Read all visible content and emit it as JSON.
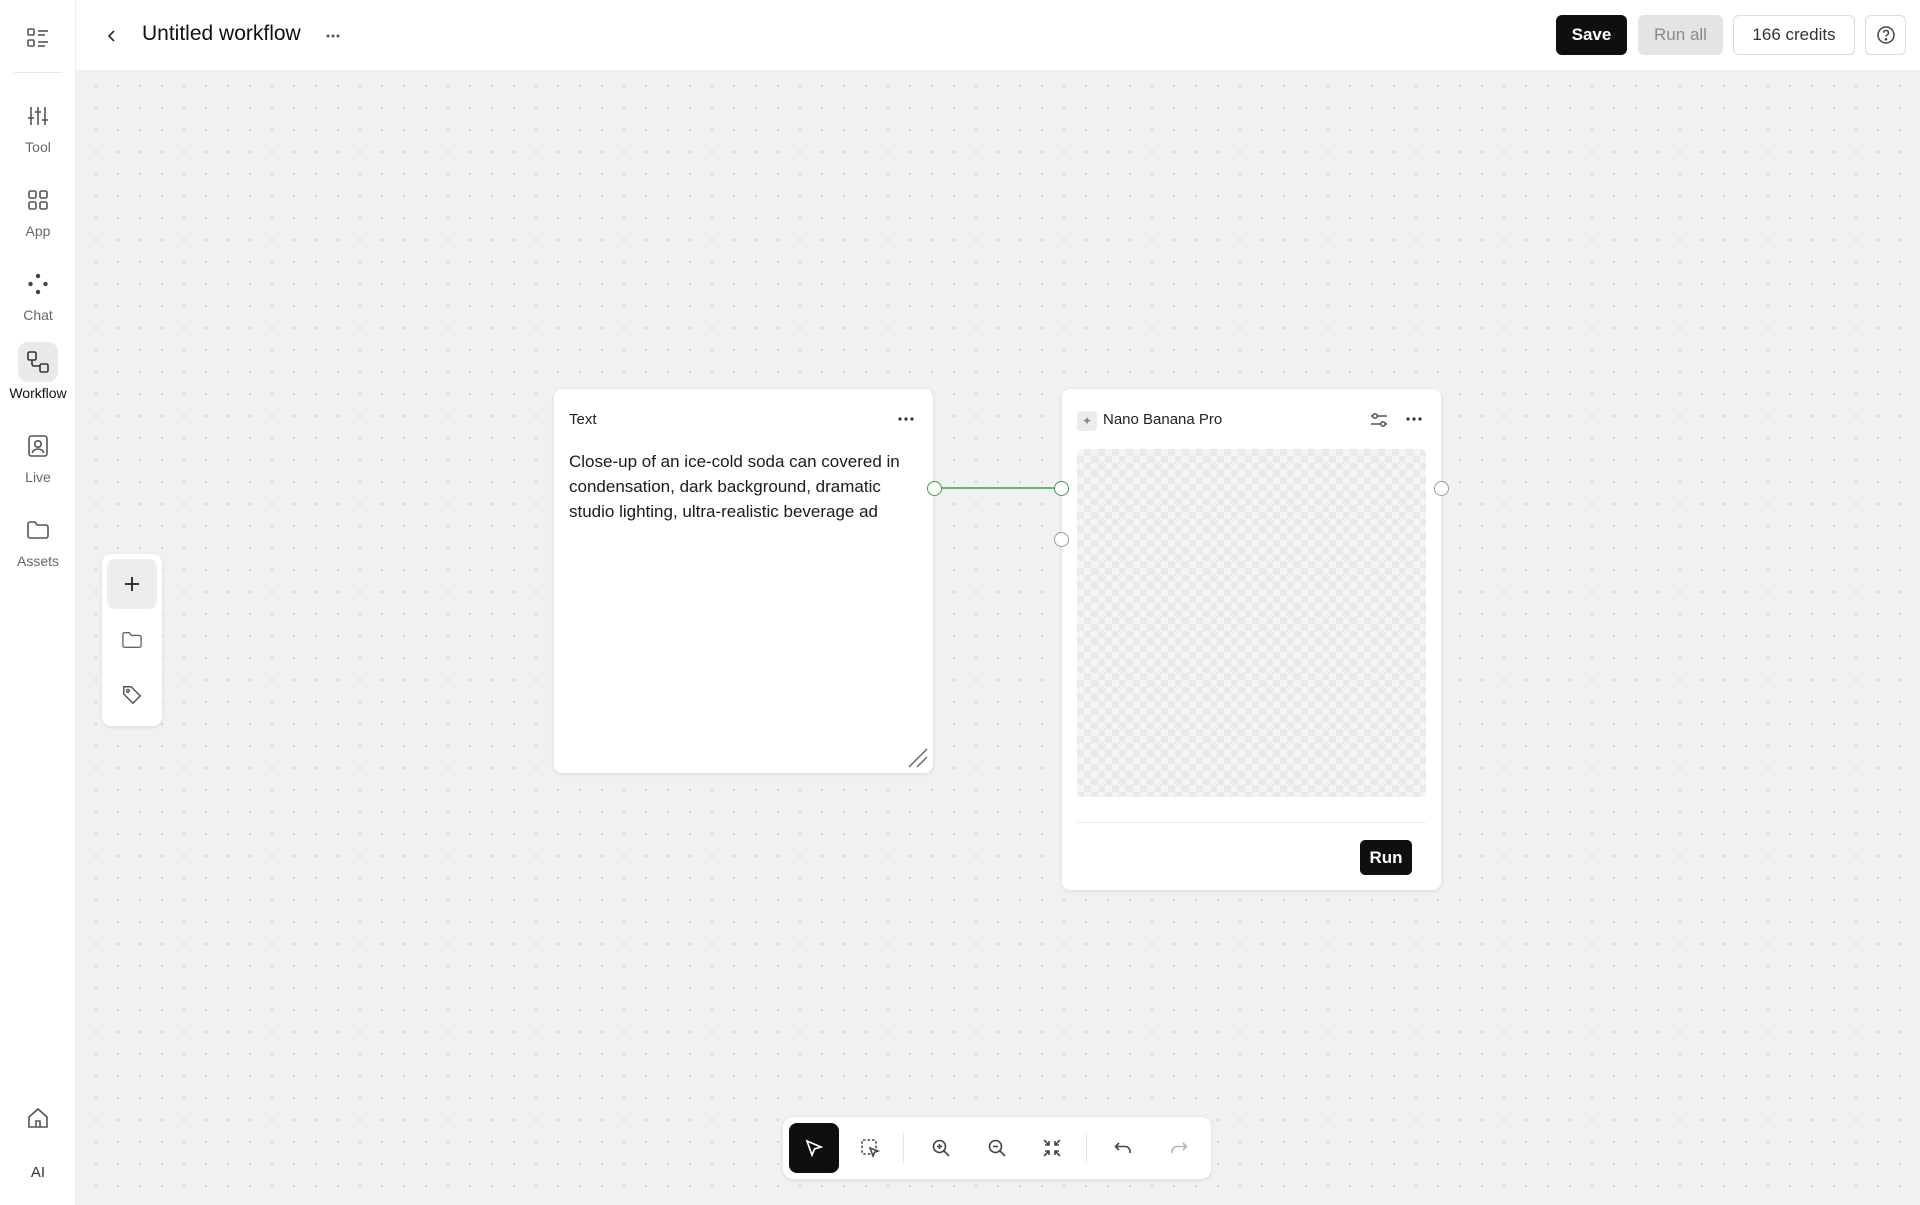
{
  "rail": {
    "items": [
      {
        "label": "Tool",
        "icon": "sliders-icon"
      },
      {
        "label": "App",
        "icon": "grid-icon"
      },
      {
        "label": "Chat",
        "icon": "dots-icon"
      },
      {
        "label": "Workflow",
        "icon": "workflow-icon",
        "active": true
      },
      {
        "label": "Live",
        "icon": "portrait-icon"
      },
      {
        "label": "Assets",
        "icon": "folder-icon"
      }
    ],
    "ai_label": "AI"
  },
  "header": {
    "title": "Untitled workflow",
    "more": "···",
    "save_label": "Save",
    "run_all_label": "Run all",
    "credits_label": "166 credits"
  },
  "nodes": {
    "text": {
      "title": "Text",
      "prompt": "Close-up of an ice-cold soda can covered in condensation, dark background, dramatic studio lighting, ultra-realistic beverage ad"
    },
    "generator": {
      "title": "Nano Banana Pro",
      "run_label": "Run"
    }
  },
  "colors": {
    "accent": "#0f0f0f",
    "edge": "#3aa04a",
    "canvas": "#f1f1f2"
  }
}
